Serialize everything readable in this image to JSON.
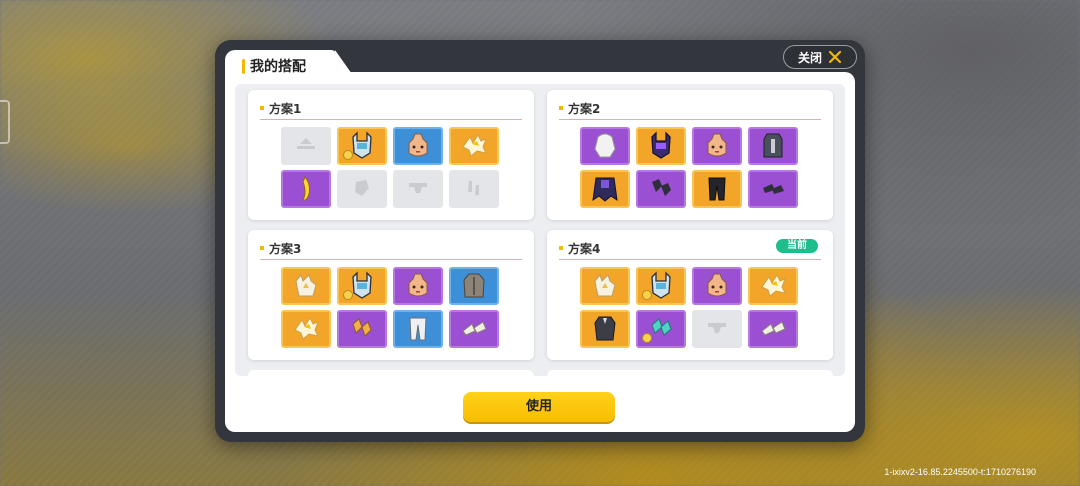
{
  "title": "我的搭配",
  "close_label": "关闭",
  "use_label": "使用",
  "version": "1-ixixv2-16.85.2245500-t:1710276190",
  "current_badge": "当前",
  "colors": {
    "accent": "#f3b800",
    "current": "#1ebd8c",
    "gold": "#f3a52a",
    "purple": "#9b4fd2",
    "blue": "#3d8fd8"
  },
  "outfits": [
    {
      "name": "方案1",
      "current": false,
      "slots": [
        {
          "rarity": "empty",
          "icon": "hat-placeholder-icon"
        },
        {
          "rarity": "gold",
          "icon": "helmet-icon",
          "coin": true
        },
        {
          "rarity": "blue",
          "icon": "face-icon"
        },
        {
          "rarity": "gold",
          "icon": "wing-icon"
        },
        {
          "rarity": "purple",
          "icon": "banana-icon"
        },
        {
          "rarity": "empty",
          "icon": "glove-placeholder-icon"
        },
        {
          "rarity": "empty",
          "icon": "pants-placeholder-icon"
        },
        {
          "rarity": "empty",
          "icon": "shoes-placeholder-icon"
        }
      ]
    },
    {
      "name": "方案2",
      "current": false,
      "slots": [
        {
          "rarity": "purple",
          "icon": "white-hood-icon"
        },
        {
          "rarity": "gold",
          "icon": "dark-helmet-icon"
        },
        {
          "rarity": "purple",
          "icon": "face-icon"
        },
        {
          "rarity": "purple",
          "icon": "dark-coat-icon"
        },
        {
          "rarity": "gold",
          "icon": "dark-cape-icon"
        },
        {
          "rarity": "purple",
          "icon": "dark-gloves-icon"
        },
        {
          "rarity": "gold",
          "icon": "dark-pants-icon"
        },
        {
          "rarity": "purple",
          "icon": "dark-shoes-icon"
        }
      ]
    },
    {
      "name": "方案3",
      "current": false,
      "slots": [
        {
          "rarity": "gold",
          "icon": "white-hat-icon"
        },
        {
          "rarity": "gold",
          "icon": "helmet-icon",
          "coin": true
        },
        {
          "rarity": "purple",
          "icon": "face-icon"
        },
        {
          "rarity": "blue",
          "icon": "grey-coat-icon"
        },
        {
          "rarity": "gold",
          "icon": "wing-icon"
        },
        {
          "rarity": "purple",
          "icon": "gold-gloves-icon"
        },
        {
          "rarity": "blue",
          "icon": "white-pants-icon"
        },
        {
          "rarity": "purple",
          "icon": "white-shoes-icon"
        }
      ]
    },
    {
      "name": "方案4",
      "current": true,
      "slots": [
        {
          "rarity": "gold",
          "icon": "white-hat-icon"
        },
        {
          "rarity": "gold",
          "icon": "helmet-icon",
          "coin": true
        },
        {
          "rarity": "purple",
          "icon": "face-icon"
        },
        {
          "rarity": "gold",
          "icon": "wing-icon"
        },
        {
          "rarity": "gold",
          "icon": "dark-suit-icon"
        },
        {
          "rarity": "purple",
          "icon": "teal-gloves-icon",
          "coin": true
        },
        {
          "rarity": "empty",
          "icon": "pants-placeholder-icon"
        },
        {
          "rarity": "purple",
          "icon": "white-shoes-icon"
        }
      ]
    }
  ]
}
